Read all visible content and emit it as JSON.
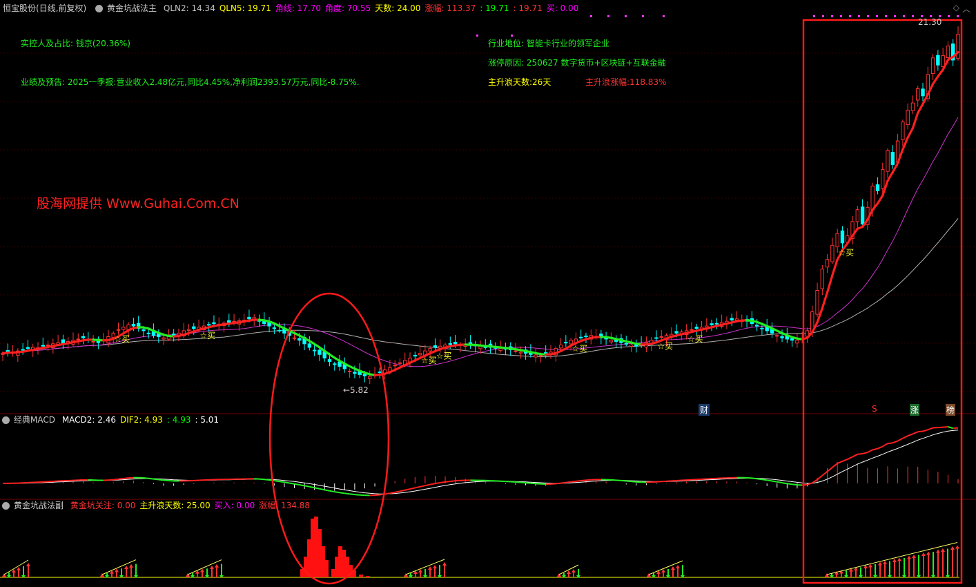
{
  "main_header": {
    "stock_name": "恒宝股份",
    "period": "(日线,前复权)",
    "indicator": "黄金坑战法主",
    "items": [
      {
        "label": "QLN2:",
        "value": "14.34",
        "color": "#c0c0c0"
      },
      {
        "label": "QLN5:",
        "value": "19.71",
        "color": "#ffff00"
      },
      {
        "label": "角线:",
        "value": "17.70",
        "color": "#ff00ff"
      },
      {
        "label": "角度:",
        "value": "70.55",
        "color": "#ff00ff"
      },
      {
        "label": "天数:",
        "value": "24.00",
        "color": "#ffff00"
      },
      {
        "label": "涨幅:",
        "value": "113.37",
        "color": "#ff3333"
      },
      {
        "label": ":",
        "value": "19.71",
        "color": "#00ff00"
      },
      {
        "label": ":",
        "value": "19.71",
        "color": "#ff3333"
      },
      {
        "label": "买:",
        "value": "0.00",
        "color": "#ff00ff"
      }
    ]
  },
  "annotations": {
    "controller": "实控人及占比: 钱京(20.36%)",
    "performance": "业绩及预告: 2025一季报:营业收入2.48亿元,同比4.45%,净利润2393.57万元,同比-8.75%.",
    "industry": "行业地位: 智能卡行业的领军企业",
    "limit_reason": "涨停原因: 250627 数字货币+区块链+互联金融",
    "wave_days": "主升浪天数:26天",
    "wave_gain": "主升浪涨幅:118.83%",
    "watermark": "股海网提供 Www.Guhai.Com.CN",
    "high_label": "21.30",
    "low_label": "←5.82",
    "buy_label": "☆买",
    "cai_tag": "财",
    "s_tag": "S",
    "zhang_tag": "涨",
    "bang_tag": "榜"
  },
  "macd_header": {
    "name": "经典MACD",
    "items": [
      {
        "label": "MACD2:",
        "value": "2.46",
        "color": "#ffffff"
      },
      {
        "label": "DIF2:",
        "value": "4.93",
        "color": "#ffff00"
      },
      {
        "label": ":",
        "value": "4.93",
        "color": "#00ff00"
      },
      {
        "label": ":",
        "value": "5.01",
        "color": "#ffffff"
      }
    ]
  },
  "sub_header": {
    "name": "黄金坑战法副",
    "items": [
      {
        "label": "黄金坑关注:",
        "value": "0.00",
        "color": "#ff3333"
      },
      {
        "label": "主升浪天数:",
        "value": "25.00",
        "color": "#ffff00"
      },
      {
        "label": "买入:",
        "value": "0.00",
        "color": "#ff00ff"
      },
      {
        "label": "涨幅:",
        "value": "134.88",
        "color": "#ff3333"
      }
    ]
  },
  "colors": {
    "up": "#ff3333",
    "down": "#00ffff",
    "ma_up": "#ff2020",
    "ma_down": "#22ee22",
    "ma20": "#cc33cc",
    "ma60": "#b0b0b0",
    "box": "#ff1a1a"
  },
  "chart_data": {
    "type": "candlestick",
    "price_range": [
      5.3,
      21.6
    ],
    "high": 21.3,
    "low": 5.82,
    "closes": [
      7.35,
      7.4,
      7.38,
      7.45,
      7.5,
      7.55,
      7.6,
      7.58,
      7.65,
      7.7,
      7.75,
      7.8,
      7.78,
      7.85,
      7.9,
      7.95,
      8.0,
      7.92,
      7.85,
      7.8,
      7.9,
      8.05,
      8.2,
      8.35,
      8.45,
      8.55,
      8.5,
      8.4,
      8.3,
      8.2,
      8.1,
      8.05,
      8.0,
      8.05,
      8.1,
      8.2,
      8.3,
      8.35,
      8.4,
      8.45,
      8.5,
      8.55,
      8.6,
      8.58,
      8.62,
      8.65,
      8.7,
      8.72,
      8.75,
      8.8,
      8.85,
      8.7,
      8.6,
      8.5,
      8.4,
      8.3,
      8.2,
      8.1,
      8.0,
      7.9,
      7.75,
      7.6,
      7.45,
      7.3,
      7.15,
      7.0,
      6.9,
      6.8,
      6.7,
      6.6,
      6.5,
      6.45,
      6.4,
      6.38,
      6.45,
      6.55,
      6.65,
      6.75,
      6.85,
      6.95,
      7.05,
      7.15,
      7.25,
      7.35,
      7.45,
      7.55,
      7.6,
      7.65,
      7.7,
      7.72,
      7.75,
      7.72,
      7.7,
      7.68,
      7.66,
      7.64,
      7.62,
      7.6,
      7.58,
      7.55,
      7.52,
      7.5,
      7.45,
      7.4,
      7.35,
      7.3,
      7.28,
      7.26,
      7.3,
      7.4,
      7.55,
      7.7,
      7.8,
      7.9,
      7.95,
      8.0,
      8.05,
      8.1,
      8.05,
      8.0,
      7.95,
      7.9,
      7.85,
      7.8,
      7.75,
      7.7,
      7.65,
      7.7,
      7.8,
      7.9,
      8.0,
      8.05,
      8.1,
      8.15,
      8.2,
      8.25,
      8.3,
      8.35,
      8.4,
      8.45,
      8.5,
      8.55,
      8.6,
      8.65,
      8.7,
      8.75,
      8.8,
      8.75,
      8.7,
      8.6,
      8.5,
      8.4,
      8.3,
      8.2,
      8.1,
      8.0,
      7.95,
      7.9,
      7.9,
      7.95,
      8.3,
      9.1,
      10.0,
      10.9,
      11.3,
      11.9,
      12.4,
      12.0,
      12.3,
      12.9,
      13.4,
      12.8,
      13.5,
      14.4,
      14.2,
      15.1,
      15.9,
      15.3,
      16.3,
      17.1,
      17.6,
      17.9,
      18.5,
      18.2,
      19.1,
      19.8,
      19.5,
      19.9,
      20.3,
      19.71,
      20.8
    ]
  }
}
